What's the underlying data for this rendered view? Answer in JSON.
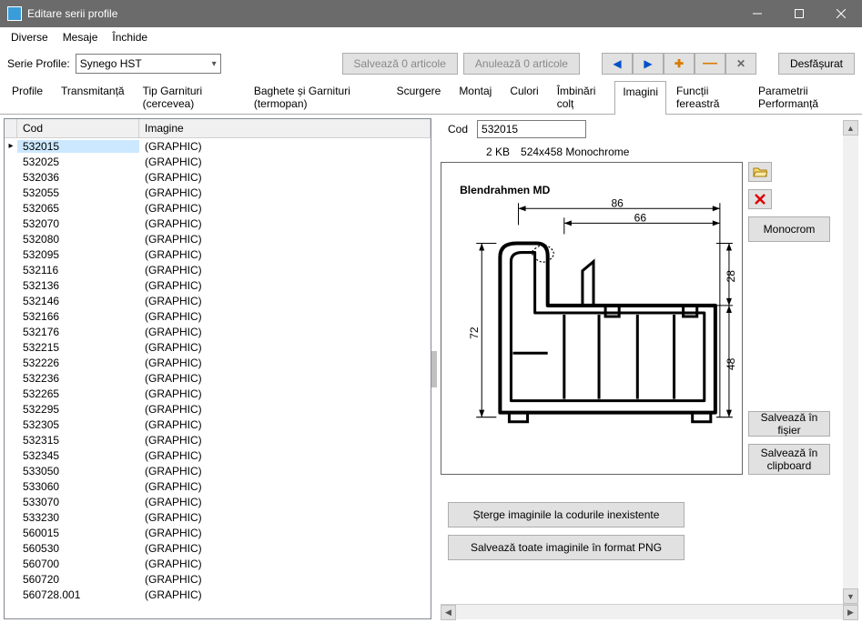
{
  "window": {
    "title": "Editare serii profile"
  },
  "menu": {
    "diverse": "Diverse",
    "mesaje": "Mesaje",
    "inchide": "Închide"
  },
  "toolbar": {
    "serie_label": "Serie Profile:",
    "serie_value": "Synego HST",
    "save_articles": "Salvează 0 articole",
    "cancel_articles": "Anulează 0 articole",
    "expand": "Desfășurat"
  },
  "tabs": {
    "profile": "Profile",
    "transmitanta": "Transmitanță",
    "tip_garnituri": "Tip Garnituri (cercevea)",
    "baghete": "Baghete și Garnituri (termopan)",
    "scurgere": "Scurgere",
    "montaj": "Montaj",
    "culori": "Culori",
    "imbinari": "Îmbinări colț",
    "imagini": "Imagini",
    "functii": "Funcții fereastră",
    "parametrii": "Parametrii Performanță"
  },
  "grid": {
    "header_cod": "Cod",
    "header_imagine": "Imagine",
    "rows": [
      {
        "cod": "532015",
        "img": "(GRAPHIC)",
        "selected": true
      },
      {
        "cod": "532025",
        "img": "(GRAPHIC)"
      },
      {
        "cod": "532036",
        "img": "(GRAPHIC)"
      },
      {
        "cod": "532055",
        "img": "(GRAPHIC)"
      },
      {
        "cod": "532065",
        "img": "(GRAPHIC)"
      },
      {
        "cod": "532070",
        "img": "(GRAPHIC)"
      },
      {
        "cod": "532080",
        "img": "(GRAPHIC)"
      },
      {
        "cod": "532095",
        "img": "(GRAPHIC)"
      },
      {
        "cod": "532116",
        "img": "(GRAPHIC)"
      },
      {
        "cod": "532136",
        "img": "(GRAPHIC)"
      },
      {
        "cod": "532146",
        "img": "(GRAPHIC)"
      },
      {
        "cod": "532166",
        "img": "(GRAPHIC)"
      },
      {
        "cod": "532176",
        "img": "(GRAPHIC)"
      },
      {
        "cod": "532215",
        "img": "(GRAPHIC)"
      },
      {
        "cod": "532226",
        "img": "(GRAPHIC)"
      },
      {
        "cod": "532236",
        "img": "(GRAPHIC)"
      },
      {
        "cod": "532265",
        "img": "(GRAPHIC)"
      },
      {
        "cod": "532295",
        "img": "(GRAPHIC)"
      },
      {
        "cod": "532305",
        "img": "(GRAPHIC)"
      },
      {
        "cod": "532315",
        "img": "(GRAPHIC)"
      },
      {
        "cod": "532345",
        "img": "(GRAPHIC)"
      },
      {
        "cod": "533050",
        "img": "(GRAPHIC)"
      },
      {
        "cod": "533060",
        "img": "(GRAPHIC)"
      },
      {
        "cod": "533070",
        "img": "(GRAPHIC)"
      },
      {
        "cod": "533230",
        "img": "(GRAPHIC)"
      },
      {
        "cod": "560015",
        "img": "(GRAPHIC)"
      },
      {
        "cod": "560530",
        "img": "(GRAPHIC)"
      },
      {
        "cod": "560700",
        "img": "(GRAPHIC)"
      },
      {
        "cod": "560720",
        "img": "(GRAPHIC)"
      },
      {
        "cod": "560728.001",
        "img": "(GRAPHIC)"
      }
    ]
  },
  "detail": {
    "cod_label": "Cod",
    "cod_value": "532015",
    "size": "2 KB",
    "dimensions": "524x458 Monochrome",
    "profile_name": "Blendrahmen MD",
    "dim_86": "86",
    "dim_66": "66",
    "dim_72": "72",
    "dim_28": "28",
    "dim_48": "48"
  },
  "side": {
    "monocrom": "Monocrom",
    "save_file": "Salvează în fișier",
    "save_clipboard": "Salvează în clipboard"
  },
  "actions": {
    "delete_images": "Șterge imaginile la codurile inexistente",
    "save_png": "Salvează toate imaginile în format PNG"
  }
}
